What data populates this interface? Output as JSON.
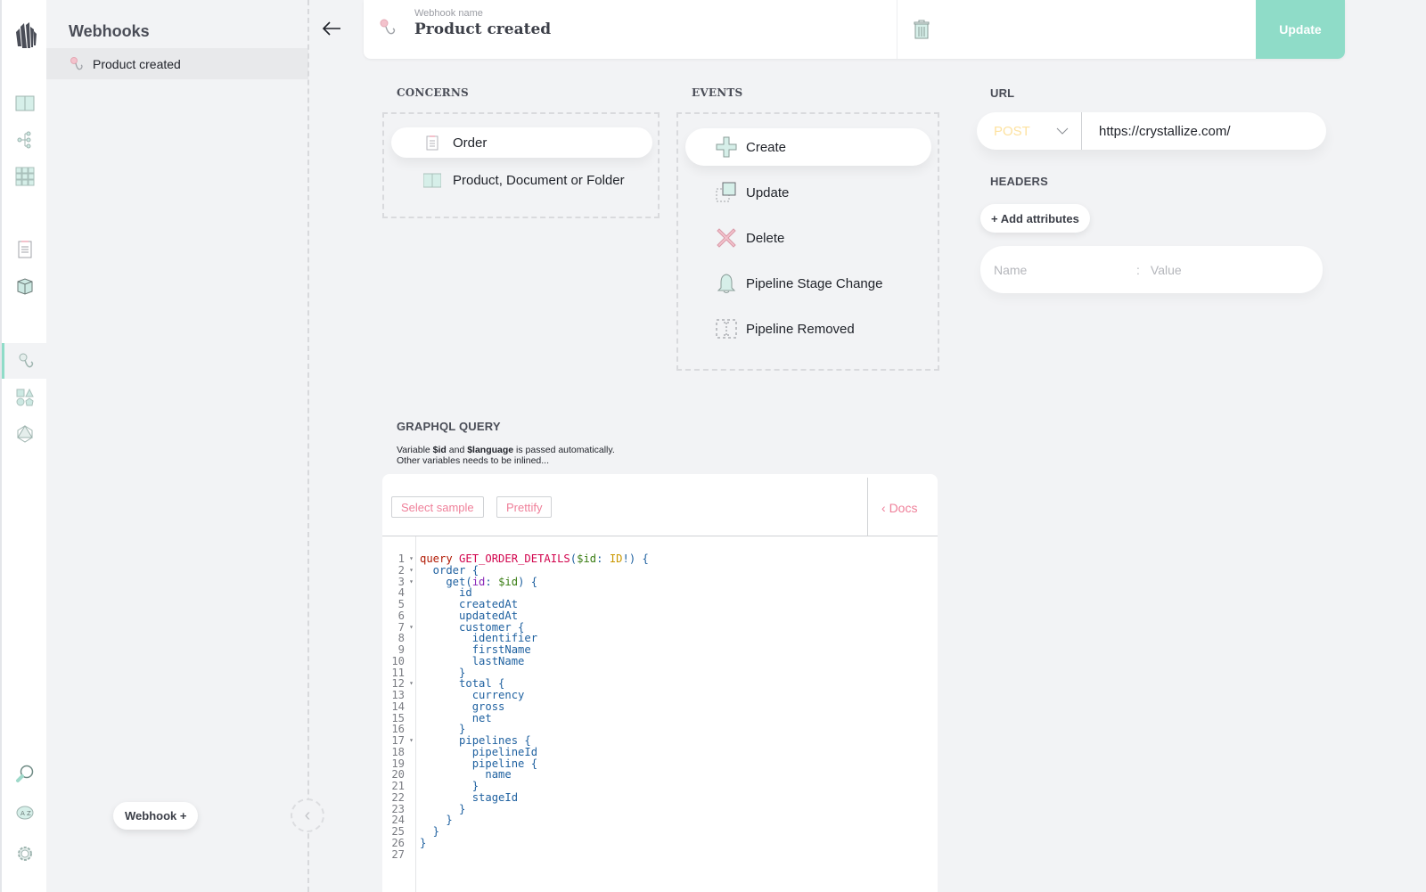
{
  "rail": {
    "items": [
      {
        "icon": "catalogue-book-icon",
        "active": false
      },
      {
        "icon": "topics-tree-icon",
        "active": false
      },
      {
        "icon": "grid-icon",
        "active": false
      },
      {
        "icon": "orders-clipboard-icon",
        "active": false
      },
      {
        "icon": "customers-box-icon",
        "active": false
      },
      {
        "icon": "webhook-icon",
        "active": true
      },
      {
        "icon": "shapes-icon",
        "active": false
      },
      {
        "icon": "graphql-icon",
        "active": false
      },
      {
        "icon": "search-icon",
        "active": false
      },
      {
        "icon": "translate-icon",
        "active": false
      },
      {
        "icon": "settings-gear-icon",
        "active": false
      }
    ]
  },
  "sidebar": {
    "title": "Webhooks",
    "items": [
      {
        "label": "Product created",
        "icon": "webhook-icon",
        "selected": true
      }
    ],
    "add_button": "Webhook +"
  },
  "header": {
    "name_label": "Webhook name",
    "name_value": "Product created",
    "update_button": "Update"
  },
  "concerns": {
    "label": "CONCERNS",
    "items": [
      {
        "label": "Order",
        "icon": "clipboard-icon",
        "selected": true
      },
      {
        "label": "Product, Document or Folder",
        "icon": "book-icon",
        "selected": false
      }
    ]
  },
  "events": {
    "label": "EVENTS",
    "items": [
      {
        "label": "Create",
        "icon": "plus-icon",
        "selected": true
      },
      {
        "label": "Update",
        "icon": "update-icon",
        "selected": false
      },
      {
        "label": "Delete",
        "icon": "delete-x-icon",
        "selected": false
      },
      {
        "label": "Pipeline Stage Change",
        "icon": "bell-icon",
        "selected": false
      },
      {
        "label": "Pipeline Removed",
        "icon": "pipeline-removed-icon",
        "selected": false
      }
    ]
  },
  "url": {
    "label": "URL",
    "method": "POST",
    "value": "https://crystallize.com/"
  },
  "headers": {
    "label": "HEADERS",
    "add_button": "+ Add attributes",
    "name_placeholder": "Name",
    "separator": ":",
    "value_placeholder": "Value"
  },
  "graphql": {
    "label": "GRAPHQL QUERY",
    "note_line1_a": "Variable ",
    "note_var1": "$id",
    "note_line1_b": " and ",
    "note_var2": "$language",
    "note_line1_c": " is passed automatically.",
    "note_line2": "Other variables needs to be inlined...",
    "select_sample": "Select sample",
    "prettify": "Prettify",
    "docs": "Docs",
    "fold_lines": [
      1,
      2,
      3,
      7,
      12,
      17
    ],
    "code_lines": [
      "query GET_ORDER_DETAILS($id: ID!) {",
      "  order {",
      "    get(id: $id) {",
      "      id",
      "      createdAt",
      "      updatedAt",
      "      customer {",
      "        identifier",
      "        firstName",
      "        lastName",
      "      }",
      "      total {",
      "        currency",
      "        gross",
      "        net",
      "      }",
      "      pipelines {",
      "        pipelineId",
      "        pipeline {",
      "          name",
      "        }",
      "        stageId",
      "      }",
      "    }",
      "  }",
      "}",
      ""
    ]
  },
  "colors": {
    "accent": "#8fdcc8",
    "pink": "#ef7f99",
    "method": "#fde2a0"
  }
}
